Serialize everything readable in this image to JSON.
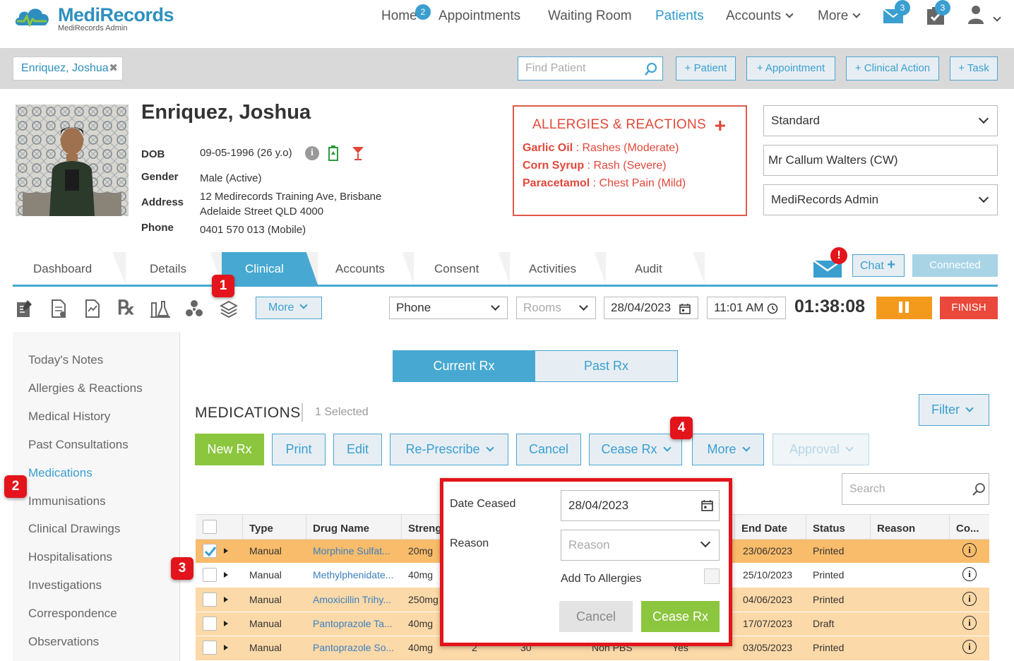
{
  "app": {
    "brand": "MediRecords",
    "brand_sub": "MediRecords Admin"
  },
  "nav": {
    "home": "Home",
    "home_badge": "2",
    "appointments": "Appointments",
    "waiting_room": "Waiting Room",
    "patients": "Patients",
    "accounts": "Accounts",
    "more": "More",
    "mail_badge": "3",
    "tasks_badge": "3"
  },
  "header": {
    "patient_tab": "Enriquez, Joshua",
    "find_placeholder": "Find Patient",
    "add_patient": "+ Patient",
    "add_appointment": "+ Appointment",
    "add_clinical_action": "+ Clinical Action",
    "add_task": "+ Task"
  },
  "patient": {
    "name": "Enriquez, Joshua",
    "dob_label": "DOB",
    "dob": "09-05-1996 (26 y.o)",
    "gender_label": "Gender",
    "gender": "Male (Active)",
    "address_label": "Address",
    "address_line1": "12 Medirecords Training Ave, Brisbane",
    "address_line2": "Adelaide Street QLD 4000",
    "phone_label": "Phone",
    "phone": "0401 570 013 (Mobile)"
  },
  "allergies": {
    "title": "ALLERGIES & REACTIONS",
    "items": [
      {
        "name": "Garlic Oil",
        "reaction": " : Rashes (Moderate)"
      },
      {
        "name": "Corn Syrup",
        "reaction": " : Rash (Severe)"
      },
      {
        "name": "Paracetamol",
        "reaction": " : Chest Pain (Mild)"
      }
    ]
  },
  "right_selects": {
    "billing": "Standard",
    "practitioner": "Mr Callum Walters (CW)",
    "location": "MediRecords Admin"
  },
  "tabs": [
    {
      "label": "Dashboard"
    },
    {
      "label": "Details"
    },
    {
      "label": "Clinical"
    },
    {
      "label": "Accounts"
    },
    {
      "label": "Consent"
    },
    {
      "label": "Activities"
    },
    {
      "label": "Audit"
    }
  ],
  "comms": {
    "chat": "Chat",
    "connected": "Connected"
  },
  "toolbar": {
    "more": "More",
    "mode": "Phone",
    "rooms_placeholder": "Rooms",
    "date": "28/04/2023",
    "time": "11:01 AM",
    "timer": "01:38:08",
    "finish": "FINISH"
  },
  "sidebar": {
    "items": [
      {
        "label": "Today's Notes"
      },
      {
        "label": "Allergies & Reactions"
      },
      {
        "label": "Medical History"
      },
      {
        "label": "Past Consultations"
      },
      {
        "label": "Medications"
      },
      {
        "label": "Immunisations"
      },
      {
        "label": "Clinical Drawings"
      },
      {
        "label": "Hospitalisations"
      },
      {
        "label": "Investigations"
      },
      {
        "label": "Correspondence"
      },
      {
        "label": "Observations"
      }
    ]
  },
  "medications": {
    "current_rx": "Current Rx",
    "past_rx": "Past Rx",
    "title": "MEDICATIONS",
    "selected": "1 Selected",
    "filter": "Filter",
    "new_rx": "New Rx",
    "print": "Print",
    "edit": "Edit",
    "re_prescribe": "Re-Prescribe",
    "cancel": "Cancel",
    "cease_rx": "Cease Rx",
    "more": "More",
    "approval": "Approval",
    "search_placeholder": "Search",
    "columns": {
      "type": "Type",
      "drug_name": "Drug Name",
      "strength": "Streng",
      "end_date": "End Date",
      "status": "Status",
      "reason": "Reason",
      "co": "Co..."
    },
    "rows": [
      {
        "type": "Manual",
        "drug": "Morphine Sulfat...",
        "strength": "20mg",
        "end_date": "23/06/2023",
        "status": "Printed",
        "checked": true
      },
      {
        "type": "Manual",
        "drug": "Methylphenidate...",
        "strength": "40mg",
        "end_date": "25/10/2023",
        "status": "Printed",
        "checked": false
      },
      {
        "type": "Manual",
        "drug": "Amoxicillin Trihy...",
        "strength": "250mg",
        "end_date": "04/06/2023",
        "status": "Printed",
        "checked": false
      },
      {
        "type": "Manual",
        "drug": "Pantoprazole Ta...",
        "strength": "40mg",
        "end_date": "17/07/2023",
        "status": "Draft",
        "checked": false
      },
      {
        "type": "Manual",
        "drug": "Pantoprazole So...",
        "strength": "40mg",
        "end_date": "03/05/2023",
        "status": "Printed",
        "checked": false
      }
    ],
    "last_row_partial": {
      "c1": "2",
      "c2": "30",
      "c3": "Non PBS",
      "c4": "Yes"
    }
  },
  "cease_popup": {
    "date_label": "Date Ceased",
    "date_value": "28/04/2023",
    "reason_label": "Reason",
    "reason_placeholder": "Reason",
    "add_allergies": "Add To Allergies",
    "cancel": "Cancel",
    "cease": "Cease Rx"
  },
  "steps": [
    "1",
    "2",
    "3",
    "4"
  ],
  "colors": {
    "accent": "#47a9d1",
    "green": "#8cc63f",
    "alert_red": "#e0483a",
    "row_highlight": "#fcd9a8",
    "row_selected": "#f9bc6b"
  }
}
